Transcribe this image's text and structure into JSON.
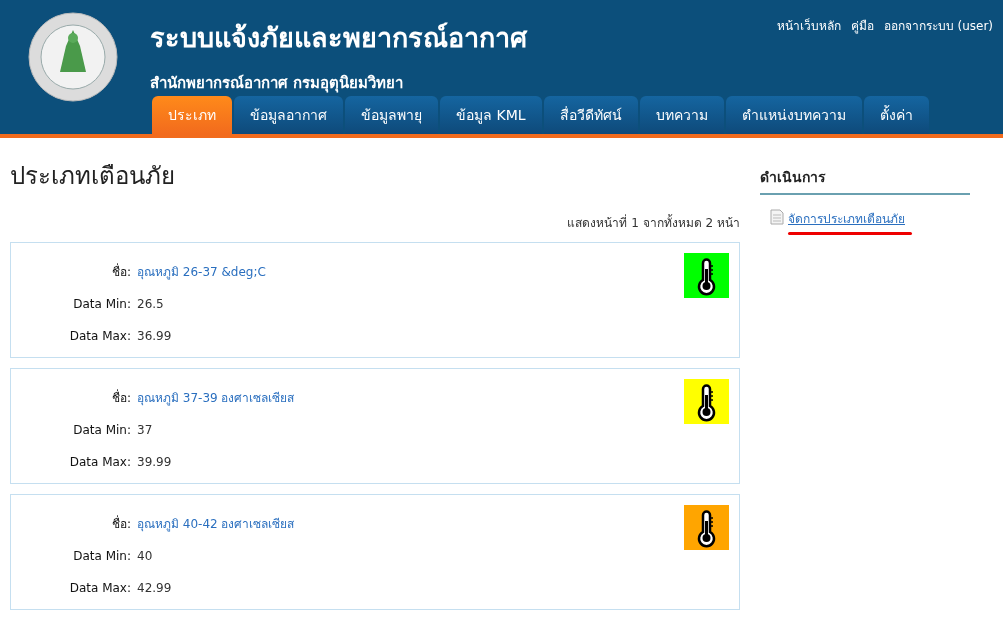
{
  "header": {
    "title": "ระบบแจ้งภัยและพยากรณ์อากาศ",
    "subtitle": "สำนักพยากรณ์อากาศ กรมอุตุนิยมวิทยา",
    "top_links": [
      "หน้าเว็บหลัก",
      "คู่มือ",
      "ออกจากระบบ (user)"
    ]
  },
  "tabs": [
    {
      "label": "ประเภท",
      "selected": true
    },
    {
      "label": "ข้อมูลอากาศ",
      "selected": false
    },
    {
      "label": "ข้อมูลพายุ",
      "selected": false
    },
    {
      "label": "ข้อมูล KML",
      "selected": false
    },
    {
      "label": "สื่อวีดีทัศน์",
      "selected": false
    },
    {
      "label": "บทความ",
      "selected": false
    },
    {
      "label": "ตำแหน่งบทความ",
      "selected": false
    },
    {
      "label": "ตั้งค่า",
      "selected": false
    }
  ],
  "page_title": "ประเภทเตือนภัย",
  "pagination": "แสดงหน้าที่ 1 จากทั้งหมด 2 หน้า",
  "items": [
    {
      "name_label": "ชื่อ:",
      "name": "อุณหภูมิ 26-37 &deg;C",
      "min_label": "Data Min:",
      "min": "26.5",
      "max_label": "Data Max:",
      "max": "36.99",
      "color": "#00ff00"
    },
    {
      "name_label": "ชื่อ:",
      "name": "อุณหภูมิ 37-39 องศาเซลเซียส",
      "min_label": "Data Min:",
      "min": "37",
      "max_label": "Data Max:",
      "max": "39.99",
      "color": "#ffff00"
    },
    {
      "name_label": "ชื่อ:",
      "name": "อุณหภูมิ 40-42 องศาเซลเซียส",
      "min_label": "Data Min:",
      "min": "40",
      "max_label": "Data Max:",
      "max": "42.99",
      "color": "#ffa500"
    }
  ],
  "sidebar": {
    "title": "ดำเนินการ",
    "links": [
      "จัดการประเภทเตือนภัย"
    ]
  }
}
